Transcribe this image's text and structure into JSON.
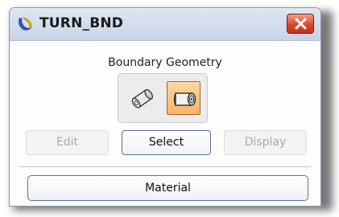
{
  "window": {
    "title": "TURN_BND"
  },
  "boundary_geometry": {
    "label": "Boundary Geometry",
    "options": [
      {
        "icon": "parts-geometry-icon",
        "selected": false
      },
      {
        "icon": "boundary-geometry-icon",
        "selected": true
      }
    ]
  },
  "actions": {
    "edit_label": "Edit",
    "select_label": "Select",
    "display_label": "Display"
  },
  "material_label": "Material",
  "colors": {
    "titlebar": "#c7d3e6",
    "close_button": "#d9492a",
    "selected_option": "#f5b469",
    "button_border": "#5a7399"
  }
}
